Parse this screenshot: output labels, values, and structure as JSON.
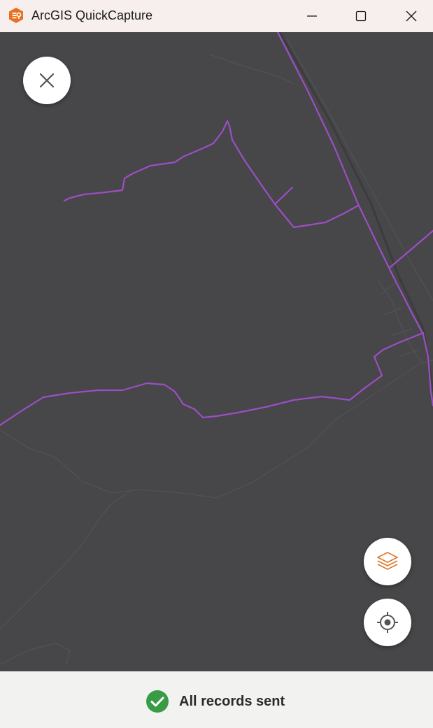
{
  "window": {
    "title": "ArcGIS QuickCapture",
    "controls": {
      "minimize_icon": "minimize-icon",
      "maximize_icon": "maximize-icon",
      "close_icon": "close-icon"
    }
  },
  "map": {
    "basemap": "dark-gray-canvas",
    "background_color": "#474649",
    "track_color": "#9b4fc4",
    "controls": {
      "close_icon": "close-icon",
      "layers_icon": "layers-icon",
      "layers_icon_color": "#e07b2e",
      "locate_icon": "gps-locate-icon"
    }
  },
  "status": {
    "icon": "check-circle-icon",
    "icon_color": "#3a9b47",
    "message": "All records sent"
  }
}
